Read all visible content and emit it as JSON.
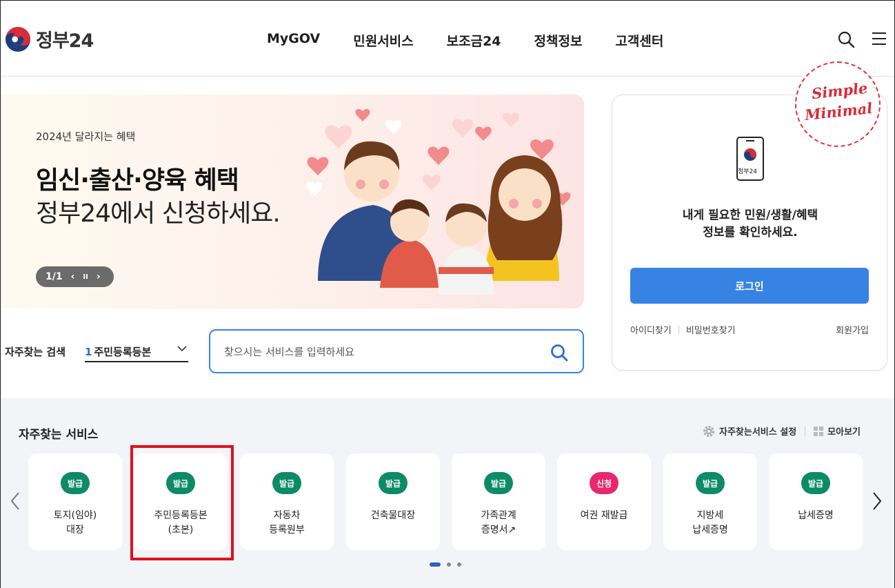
{
  "header": {
    "logo_text": "정부24",
    "nav": [
      "MyGOV",
      "민원서비스",
      "보조금24",
      "정책정보",
      "고객센터"
    ]
  },
  "banner": {
    "subtitle": "2024년 달라지는 혜택",
    "title": "임신·출산·양육 혜택",
    "title2": "정부24에서 신청하세요.",
    "counter": "1/1",
    "prev": "‹",
    "pause": "II",
    "next": "›"
  },
  "login": {
    "phone_label": "정부24",
    "message_line1": "내게 필요한 민원/생활/혜택",
    "message_line2": "정보를 확인하세요.",
    "button": "로그인",
    "find_id": "아이디찾기",
    "find_pw": "비밀번호찾기",
    "join": "회원가입",
    "stamp_line1": "Simple",
    "stamp_line2": "Minimal"
  },
  "search": {
    "frequent_label": "자주찾는 검색",
    "frequent_num": "1",
    "frequent_value": "주민등록등본",
    "placeholder": "찾으시는 서비스를 입력하세요"
  },
  "services": {
    "title": "자주찾는 서비스",
    "settings": "자주찾는서비스 설정",
    "view_all": "모아보기",
    "colors": {
      "issue": "#0d8a66",
      "apply": "#e8276e"
    },
    "cards": [
      {
        "badge": "발급",
        "type": "issue",
        "label": "토지(임야)\n대장"
      },
      {
        "badge": "발급",
        "type": "issue",
        "label": "주민등록등본\n(초본)"
      },
      {
        "badge": "발급",
        "type": "issue",
        "label": "자동차\n등록원부"
      },
      {
        "badge": "발급",
        "type": "issue",
        "label": "건축물대장"
      },
      {
        "badge": "발급",
        "type": "issue",
        "label": "가족관계\n증명서↗"
      },
      {
        "badge": "신청",
        "type": "apply",
        "label": "여권 재발급"
      },
      {
        "badge": "발급",
        "type": "issue",
        "label": "지방세\n납세증명"
      },
      {
        "badge": "발급",
        "type": "issue",
        "label": "납세증명"
      }
    ],
    "page_count": 3,
    "active_page": 1
  }
}
